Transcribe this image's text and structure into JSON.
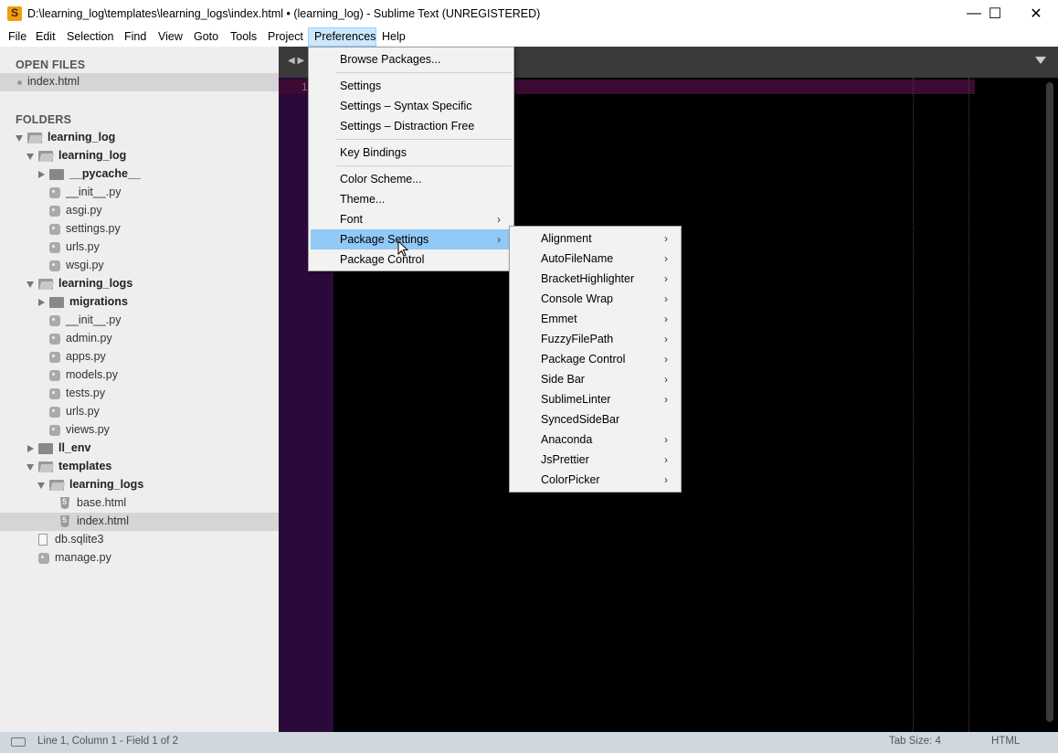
{
  "window": {
    "title": "D:\\learning_log\\templates\\learning_logs\\index.html • (learning_log) - Sublime Text (UNREGISTERED)",
    "minimize_glyph": "—",
    "maximize_glyph": "☐",
    "close_glyph": "✕"
  },
  "menubar": {
    "items": [
      "File",
      "Edit",
      "Selection",
      "Find",
      "View",
      "Goto",
      "Tools",
      "Project",
      "Preferences",
      "Help"
    ],
    "active": "Preferences"
  },
  "sidebar": {
    "open_files_heading": "OPEN FILES",
    "open_files": [
      "index.html"
    ],
    "folders_heading": "FOLDERS",
    "tree": [
      {
        "label": "learning_log",
        "kind": "folder-open",
        "depth": 0
      },
      {
        "label": "learning_log",
        "kind": "folder-open",
        "depth": 1
      },
      {
        "label": "__pycache__",
        "kind": "folder-closed",
        "depth": 2
      },
      {
        "label": "__init__.py",
        "kind": "py",
        "depth": 2
      },
      {
        "label": "asgi.py",
        "kind": "py",
        "depth": 2
      },
      {
        "label": "settings.py",
        "kind": "py",
        "depth": 2
      },
      {
        "label": "urls.py",
        "kind": "py",
        "depth": 2
      },
      {
        "label": "wsgi.py",
        "kind": "py",
        "depth": 2
      },
      {
        "label": "learning_logs",
        "kind": "folder-open",
        "depth": 1
      },
      {
        "label": "migrations",
        "kind": "folder-closed",
        "depth": 2
      },
      {
        "label": "__init__.py",
        "kind": "py",
        "depth": 2
      },
      {
        "label": "admin.py",
        "kind": "py",
        "depth": 2
      },
      {
        "label": "apps.py",
        "kind": "py",
        "depth": 2
      },
      {
        "label": "models.py",
        "kind": "py",
        "depth": 2
      },
      {
        "label": "tests.py",
        "kind": "py",
        "depth": 2
      },
      {
        "label": "urls.py",
        "kind": "py",
        "depth": 2
      },
      {
        "label": "views.py",
        "kind": "py",
        "depth": 2
      },
      {
        "label": "ll_env",
        "kind": "folder-closed",
        "depth": 1
      },
      {
        "label": "templates",
        "kind": "folder-open",
        "depth": 1
      },
      {
        "label": "learning_logs",
        "kind": "folder-open",
        "depth": 2
      },
      {
        "label": "base.html",
        "kind": "html",
        "depth": 3
      },
      {
        "label": "index.html",
        "kind": "html",
        "depth": 3,
        "selected": true
      },
      {
        "label": "db.sqlite3",
        "kind": "plain",
        "depth": 1
      },
      {
        "label": "manage.py",
        "kind": "py",
        "depth": 1
      }
    ]
  },
  "editor": {
    "line_number": "1"
  },
  "preferences_menu": {
    "items": [
      {
        "label": "Browse Packages..."
      },
      {
        "sep": true
      },
      {
        "label": "Settings"
      },
      {
        "label": "Settings – Syntax Specific"
      },
      {
        "label": "Settings – Distraction Free"
      },
      {
        "sep": true
      },
      {
        "label": "Key Bindings"
      },
      {
        "sep": true
      },
      {
        "label": "Color Scheme..."
      },
      {
        "label": "Theme..."
      },
      {
        "label": "Font",
        "submenu": true
      },
      {
        "label": "Package Settings",
        "submenu": true,
        "hover": true
      },
      {
        "label": "Package Control"
      }
    ]
  },
  "package_settings_menu": {
    "items": [
      {
        "label": "Alignment",
        "submenu": true
      },
      {
        "label": "AutoFileName",
        "submenu": true
      },
      {
        "label": "BracketHighlighter",
        "submenu": true
      },
      {
        "label": "Console Wrap",
        "submenu": true
      },
      {
        "label": "Emmet",
        "submenu": true
      },
      {
        "label": "FuzzyFilePath",
        "submenu": true
      },
      {
        "label": "Package Control",
        "submenu": true
      },
      {
        "label": "Side Bar",
        "submenu": true
      },
      {
        "label": "SublimeLinter",
        "submenu": true
      },
      {
        "label": "SyncedSideBar",
        "submenu": false
      },
      {
        "label": "Anaconda",
        "submenu": true
      },
      {
        "label": "JsPrettier",
        "submenu": true
      },
      {
        "label": "ColorPicker",
        "submenu": true
      }
    ]
  },
  "statusbar": {
    "position": "Line 1, Column 1 - Field 1 of 2",
    "tab_size": "Tab Size: 4",
    "syntax": "HTML"
  }
}
